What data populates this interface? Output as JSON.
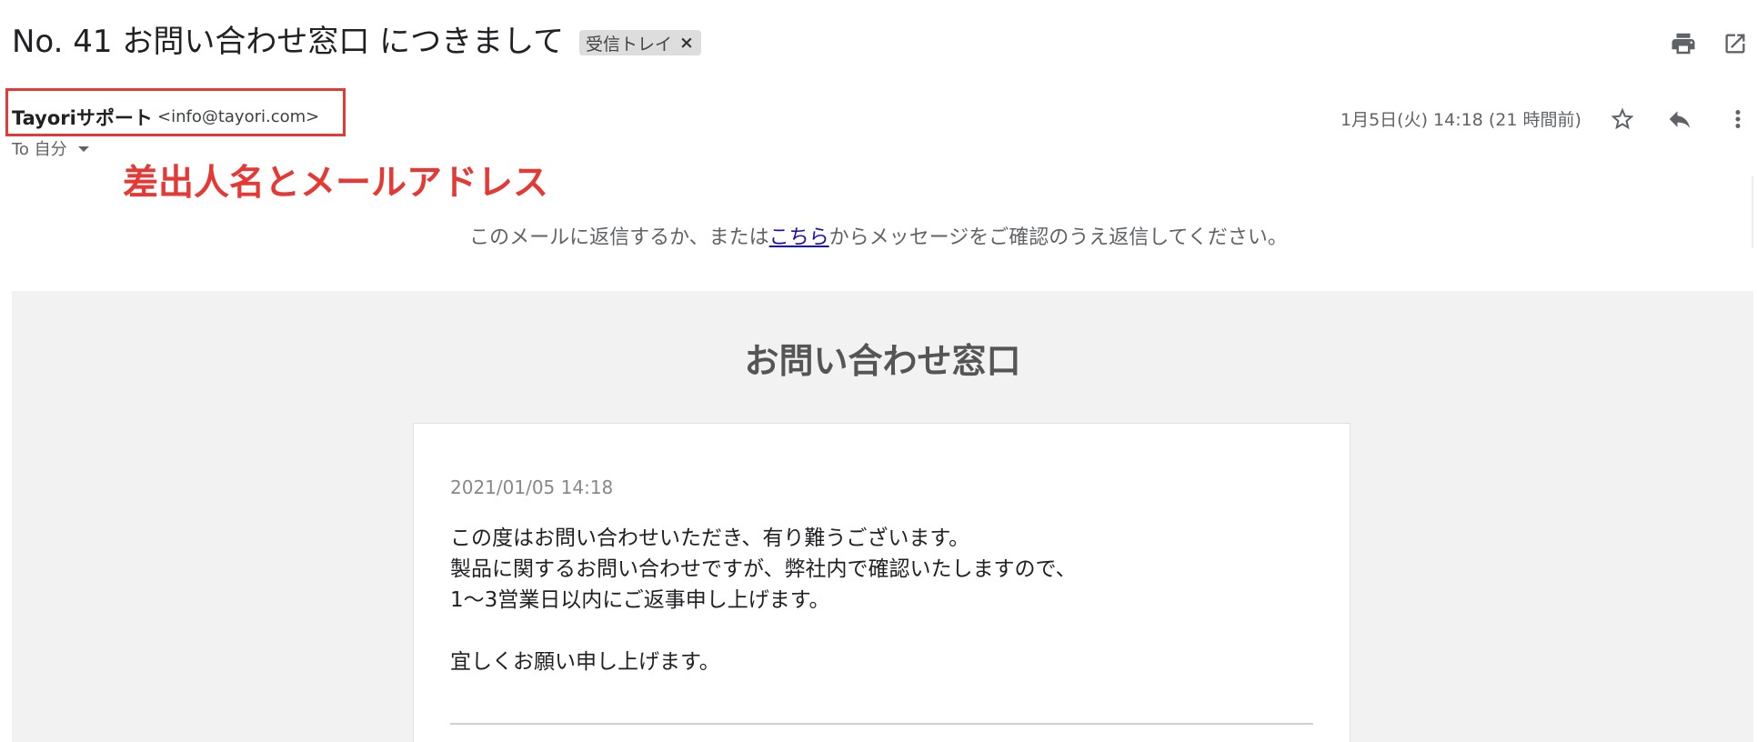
{
  "email": {
    "subject": "No. 41 お問い合わせ窓口 につきまして",
    "label": "受信トレイ",
    "label_remove": "×",
    "sender_name": "Tayoriサポート",
    "sender_email": "<info@tayori.com>",
    "recipient": "To 自分",
    "date": "1月5日(火) 14:18 (21 時間前)"
  },
  "annotation": "差出人名とメールアドレス",
  "reply_note": {
    "before": "このメールに返信するか、または",
    "link": "こちら",
    "after": "からメッセージをご確認のうえ返信してください。"
  },
  "content": {
    "title": "お問い合わせ窓口",
    "timestamp": "2021/01/05 14:18",
    "lines": [
      "この度はお問い合わせいただき、有り難うございます。",
      "製品に関するお問い合わせですが、弊社内で確認いたしますので、",
      "1〜3営業日以内にご返事申し上げます。",
      "",
      "宜しくお願い申し上げます。"
    ]
  },
  "icons": {
    "print": "print-icon",
    "open_new_window": "open-in-new-icon",
    "star": "star-outline-icon",
    "reply": "reply-icon",
    "more": "more-vert-icon"
  },
  "colors": {
    "annotation_red": "#e53935",
    "link_blue": "#1a0dab",
    "content_bg": "#f2f2f2"
  }
}
